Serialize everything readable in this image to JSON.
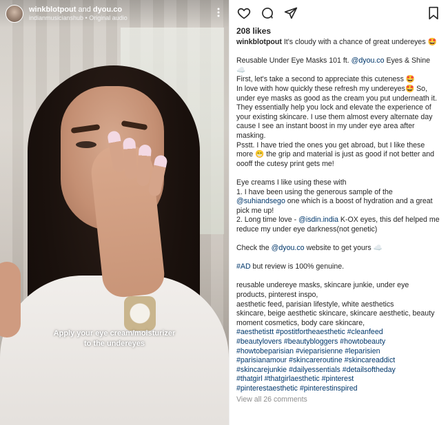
{
  "video": {
    "author": "winkblotpout",
    "and_text": "and",
    "collab": "dyou.co",
    "subtitle": "indianmusicianshub • Original audio",
    "overlay_line1": "Apply your eye cream/moisturizer",
    "overlay_line2": "to the undereyes"
  },
  "post": {
    "likes": "208 likes",
    "caption_user": "winkblotpout",
    "caption_first": " It's cloudy with a chance of great undereyes 🤩",
    "lines": [
      [
        "Reusable Under Eye Masks 101 ft. ",
        "@dyou.co",
        " Eyes & Shine ☁️"
      ],
      [
        "First, let's take a second to appreciate this cuteness 🤩"
      ],
      [
        "In love with how quickly these refresh my undereyes🤩 So,"
      ],
      [
        "under eye masks as good as the cream you put underneath it."
      ],
      [
        "They essentially help you lock and elevate the experience of"
      ],
      [
        "your existing skincare. I use them almost every alternate day"
      ],
      [
        "cause I see an instant boost in my under eye area after"
      ],
      [
        "masking."
      ],
      [
        "Psstt. I have tried the ones you get abroad, but I like these"
      ],
      [
        "more 😁 the grip and material is just as good if not better and"
      ],
      [
        "oooff the cutesy print gets me!"
      ],
      [
        ""
      ],
      [
        "Eye creams I like using these with"
      ],
      [
        "1. I have been using the generous sample of the"
      ],
      [
        "",
        "@suhiandsego",
        " one which is a boost of hydration and a great"
      ],
      [
        "pick me up!"
      ],
      [
        "2. Long time love - ",
        "@isdin.india",
        " K-OX eyes, this def helped me"
      ],
      [
        "reduce my under eye darkness(not genetic)"
      ],
      [
        ""
      ],
      [
        "Check the ",
        "@dyou.co",
        " website to get yours ☁️"
      ],
      [
        ""
      ],
      [
        "",
        "#AD",
        " but review is 100% genuine."
      ],
      [
        ""
      ],
      [
        "reusable undereye masks, skincare junkie, under eye"
      ],
      [
        "products, pinterest inspo,"
      ],
      [
        "aesthetic feed, parisian lifestyle, white aesthetics"
      ],
      [
        "skincare, beige aesthetic skincare, skincare aesthetic, beauty"
      ],
      [
        "moment cosmetics, body care skincare,"
      ]
    ],
    "hashtag_lines": [
      "#aesthetistt #postitfortheaesthetic #cleanfeed",
      "#beautylovers #beautybloggers #howtobeauty",
      "#howtobeparisian #vieparisienne #leparisien",
      "#parisianamour #skincareroutine #skincareaddict",
      "#skincarejunkie #dailyessentials #detailsoftheday",
      "#thatgirl #thatgirlaesthetic #pinterest",
      "#pinterestaesthetic #pinterestinspired"
    ],
    "view_all": "View all 26 comments"
  },
  "icons": [
    "heart-icon",
    "comment-icon",
    "share-icon",
    "bookmark-icon",
    "more-icon"
  ],
  "colors": {
    "link": "#00376b",
    "text": "#262626",
    "muted": "#8e8e8e"
  }
}
